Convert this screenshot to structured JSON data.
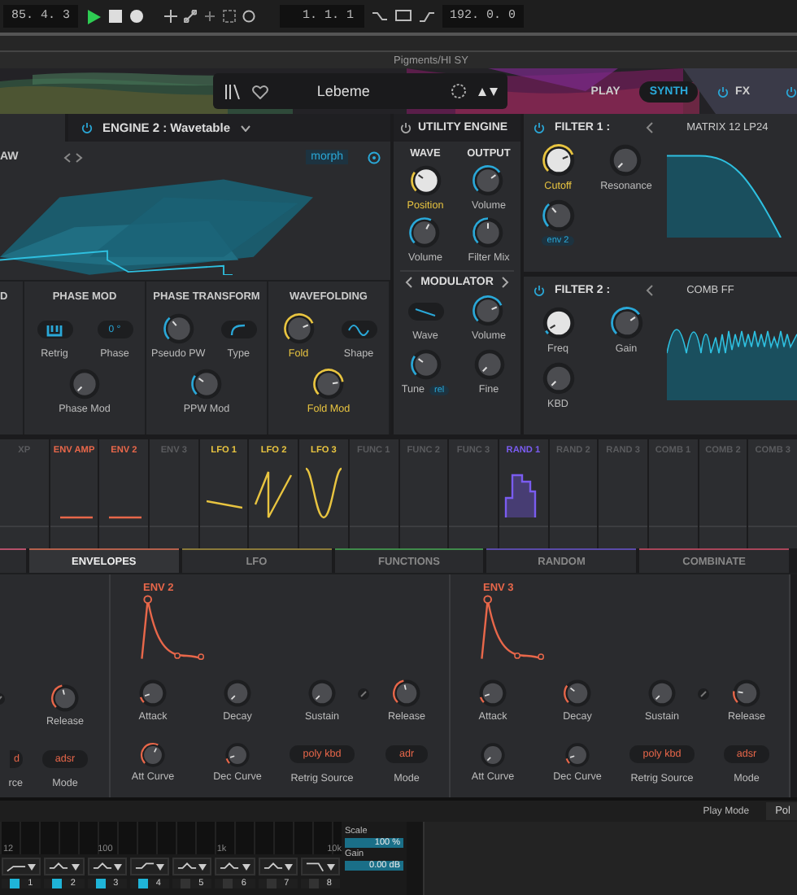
{
  "transport": {
    "position": "85. 4. 3",
    "time": "1. 1. 1",
    "tempo": "192. 0. 0"
  },
  "track_title": "Pigments/HI SY",
  "preset": {
    "name": "Lebeme"
  },
  "nav": [
    {
      "label": "PLAY",
      "selected": false,
      "power": false
    },
    {
      "label": "SYNTH",
      "selected": true,
      "power": false
    },
    {
      "label": "FX",
      "selected": false,
      "power": true
    }
  ],
  "engine": {
    "label": "ENGINE 2 : Wavetable",
    "wavetable": "AW",
    "mod_target": "morph",
    "sections": [
      {
        "title": "D"
      },
      {
        "title": "PHASE MOD",
        "controls": [
          {
            "kind": "keyboard",
            "label": "Retrig",
            "highlighted": false
          },
          {
            "kind": "value",
            "value": "0 °",
            "label": "Phase",
            "highlighted": false
          },
          {
            "kind": "knob",
            "label": "Phase Mod",
            "highlighted": false
          }
        ]
      },
      {
        "title": "PHASE TRANSFORM",
        "controls": [
          {
            "kind": "knob",
            "label": "Pseudo PW",
            "highlighted": false
          },
          {
            "kind": "curve",
            "label": "Type",
            "highlighted": false
          },
          {
            "kind": "knob",
            "label": "PPW Mod",
            "highlighted": false
          }
        ]
      },
      {
        "title": "WAVEFOLDING",
        "controls": [
          {
            "kind": "knob",
            "label": "Fold",
            "highlighted": true
          },
          {
            "kind": "sine",
            "label": "Shape",
            "highlighted": false
          },
          {
            "kind": "knob",
            "label": "Fold Mod",
            "highlighted": true
          }
        ]
      }
    ]
  },
  "utility": {
    "title": "UTILITY ENGINE",
    "columns": [
      "WAVE",
      "OUTPUT"
    ],
    "controls": [
      {
        "kind": "knob-light",
        "label": "Position",
        "highlighted": true
      },
      {
        "kind": "knob",
        "label": "Volume",
        "highlighted": false
      },
      {
        "kind": "knob",
        "label": "Volume",
        "highlighted": false
      },
      {
        "kind": "knob",
        "label": "Filter Mix",
        "highlighted": false
      }
    ],
    "modulator": {
      "title": "MODULATOR",
      "controls": [
        {
          "kind": "ramp",
          "label": "Wave",
          "highlighted": false
        },
        {
          "kind": "knob",
          "label": "Volume",
          "highlighted": false
        },
        {
          "kind": "knob",
          "label": "Tune",
          "highlighted": false,
          "tag": "rel"
        },
        {
          "kind": "knob",
          "label": "Fine",
          "highlighted": false
        }
      ]
    }
  },
  "filters": [
    {
      "title": "FILTER 1 :",
      "type": "MATRIX 12 LP24",
      "controls": [
        {
          "kind": "knob-light",
          "label": "Cutoff",
          "highlighted": true
        },
        {
          "kind": "knob",
          "label": "Resonance",
          "highlighted": false
        },
        {
          "kind": "knob",
          "tag": "env 2"
        }
      ]
    },
    {
      "title": "FILTER 2 :",
      "type": "COMB FF",
      "controls": [
        {
          "kind": "knob-light",
          "label": "Freq",
          "highlighted": false
        },
        {
          "kind": "knob",
          "label": "Gain",
          "highlighted": false
        },
        {
          "kind": "knob",
          "label": "KBD",
          "highlighted": false
        }
      ]
    }
  ],
  "mod_sources": [
    {
      "label": "XP",
      "color": "#5a5b5e",
      "kind": "none"
    },
    {
      "label": "ENV AMP",
      "color": "#e8674a",
      "kind": "flat"
    },
    {
      "label": "ENV 2",
      "color": "#e8674a",
      "kind": "flat"
    },
    {
      "label": "ENV 3",
      "color": "#5a5b5e",
      "kind": "none"
    },
    {
      "label": "LFO 1",
      "color": "#e8c440",
      "kind": "ramp"
    },
    {
      "label": "LFO 2",
      "color": "#e8c440",
      "kind": "saw"
    },
    {
      "label": "LFO 3",
      "color": "#e8c440",
      "kind": "sine"
    },
    {
      "label": "FUNC 1",
      "color": "#5a5b5e",
      "kind": "none"
    },
    {
      "label": "FUNC 2",
      "color": "#5a5b5e",
      "kind": "none"
    },
    {
      "label": "FUNC 3",
      "color": "#5a5b5e",
      "kind": "none"
    },
    {
      "label": "RAND 1",
      "color": "#7a5cf0",
      "kind": "steps"
    },
    {
      "label": "RAND 2",
      "color": "#5a5b5e",
      "kind": "none"
    },
    {
      "label": "RAND 3",
      "color": "#5a5b5e",
      "kind": "none"
    },
    {
      "label": "COMB 1",
      "color": "#5a5b5e",
      "kind": "none"
    },
    {
      "label": "COMB 2",
      "color": "#5a5b5e",
      "kind": "none"
    },
    {
      "label": "COMB 3",
      "color": "#5a5b5e",
      "kind": "none"
    }
  ],
  "tabs": [
    {
      "label": "ENVELOPES",
      "selected": true,
      "color": "#b5604c"
    },
    {
      "label": "LFO",
      "selected": false,
      "color": "#8a7a3a"
    },
    {
      "label": "FUNCTIONS",
      "selected": false,
      "color": "#3f8a4a"
    },
    {
      "label": "RANDOM",
      "selected": false,
      "color": "#5a4aa8"
    },
    {
      "label": "COMBINATE",
      "selected": false,
      "color": "#a8455a"
    }
  ],
  "envelopes": [
    {
      "kind": "partial",
      "release": {
        "kind": "knob",
        "label": "Release"
      },
      "retrig_value": "d",
      "retrig_label": "rce",
      "mode_label": "Mode",
      "mode_value": "adsr"
    },
    {
      "kind": "full",
      "title": "ENV 2",
      "knobs": [
        {
          "kind": "knob",
          "label": "Attack"
        },
        {
          "kind": "knob",
          "label": "Decay"
        },
        {
          "kind": "knob",
          "label": "Sustain"
        },
        {
          "kind": "knob",
          "label": "Release"
        }
      ],
      "curves": [
        {
          "kind": "knob",
          "label": "Att Curve"
        },
        {
          "kind": "knob",
          "label": "Dec Curve"
        }
      ],
      "retrig_label": "Retrig Source",
      "retrig_value": "poly kbd",
      "mode_label": "Mode",
      "mode_value": "adr"
    },
    {
      "kind": "full",
      "title": "ENV 3",
      "knobs": [
        {
          "kind": "knob",
          "label": "Attack"
        },
        {
          "kind": "knob",
          "label": "Decay"
        },
        {
          "kind": "knob",
          "label": "Sustain"
        },
        {
          "kind": "knob",
          "label": "Release"
        }
      ],
      "curves": [
        {
          "kind": "knob",
          "label": "Att Curve"
        },
        {
          "kind": "knob",
          "label": "Dec Curve"
        }
      ],
      "retrig_label": "Retrig Source",
      "retrig_value": "poly kbd",
      "mode_label": "Mode",
      "mode_value": "adsr"
    }
  ],
  "play_mode": {
    "label": "Play Mode",
    "value": "Pol"
  },
  "eq": {
    "freq_labels": [
      "12",
      "100",
      "1k",
      "10k"
    ],
    "bands": [
      {
        "kind": "highpass",
        "number": "1",
        "on": true
      },
      {
        "kind": "bell",
        "number": "2",
        "on": true
      },
      {
        "kind": "bell",
        "number": "3",
        "on": true
      },
      {
        "kind": "shelf",
        "number": "4",
        "on": true
      },
      {
        "kind": "bell",
        "number": "5",
        "on": false
      },
      {
        "kind": "bell",
        "number": "6",
        "on": false
      },
      {
        "kind": "bell",
        "number": "7",
        "on": false
      },
      {
        "kind": "lowpass",
        "number": "8",
        "on": false
      }
    ],
    "scale": {
      "label": "Scale",
      "value": "100 %"
    },
    "gain": {
      "label": "Gain",
      "value": "0.00 dB"
    }
  }
}
